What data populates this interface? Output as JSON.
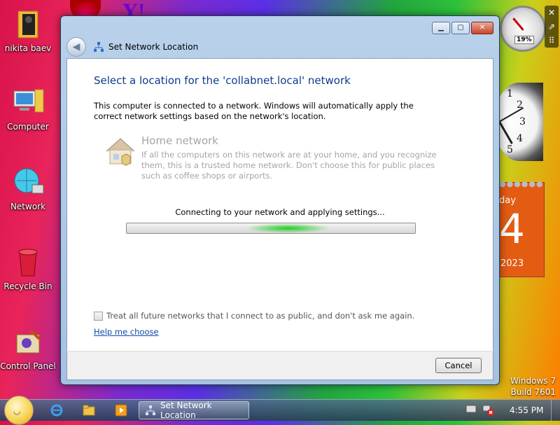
{
  "desktop": {
    "icons": [
      {
        "label": "nikita baev"
      },
      {
        "label": "Computer"
      },
      {
        "label": "Network"
      },
      {
        "label": "Recycle Bin"
      },
      {
        "label": "Control Panel"
      }
    ],
    "calendar": {
      "day": "day",
      "date": "4",
      "year": "2023"
    },
    "cpu_gauge": {
      "percent": "19%"
    },
    "watermark": {
      "line1": "Windows 7",
      "line2": "Build 7601"
    }
  },
  "window": {
    "title": "Set Network Location",
    "heading": "Select a location for the 'collabnet.local' network",
    "description": "This computer is connected to a network. Windows will automatically apply the correct network settings based on the network's location.",
    "option": {
      "title": "Home network",
      "description": "If all the computers on this network are at your home, and you recognize them, this is a trusted home network.  Don't choose this for public places such as coffee shops or airports."
    },
    "status": "Connecting to your network and applying settings...",
    "progress_indeterminate": true,
    "checkbox": {
      "label": "Treat all future networks that I connect to as public, and don't ask me again.",
      "checked": false
    },
    "help_link": "Help me choose",
    "cancel_label": "Cancel"
  },
  "taskbar": {
    "task_label": "Set Network Location",
    "time": "4:55 PM"
  },
  "colors": {
    "heading": "#0e3b8a",
    "link": "#0e4aa8",
    "disabled_text": "#a5a5a5",
    "progress_glow": "#28c82a"
  }
}
